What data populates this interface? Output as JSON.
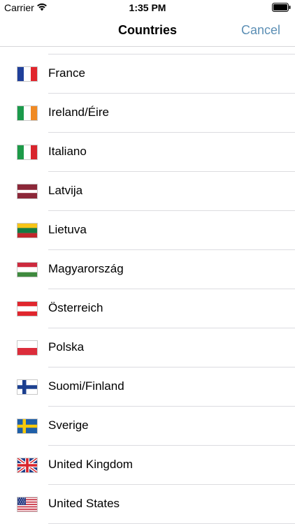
{
  "status_bar": {
    "carrier": "Carrier",
    "time": "1:35 PM"
  },
  "nav": {
    "title": "Countries",
    "cancel_label": "Cancel"
  },
  "countries": [
    {
      "label": "France",
      "flag": "france-flag"
    },
    {
      "label": "Ireland/Éire",
      "flag": "ireland-flag"
    },
    {
      "label": "Italiano",
      "flag": "italy-flag"
    },
    {
      "label": "Latvija",
      "flag": "latvia-flag"
    },
    {
      "label": "Lietuva",
      "flag": "lithuania-flag"
    },
    {
      "label": "Magyarország",
      "flag": "hungary-flag"
    },
    {
      "label": "Österreich",
      "flag": "austria-flag"
    },
    {
      "label": "Polska",
      "flag": "poland-flag"
    },
    {
      "label": "Suomi/Finland",
      "flag": "finland-flag"
    },
    {
      "label": "Sverige",
      "flag": "sweden-flag"
    },
    {
      "label": "United Kingdom",
      "flag": "uk-flag"
    },
    {
      "label": "United States",
      "flag": "us-flag"
    }
  ],
  "colors": {
    "accent": "#5c8fb5",
    "separator": "#dcdce0"
  }
}
